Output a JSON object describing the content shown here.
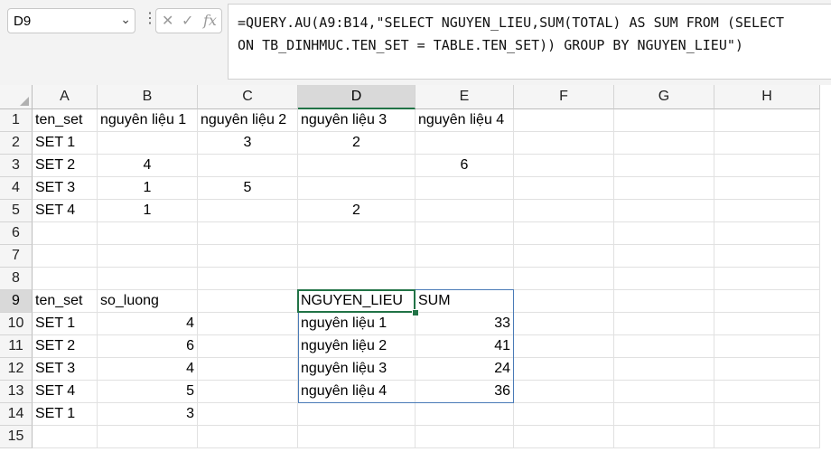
{
  "name_box": "D9",
  "formula": "=QUERY.AU(A9:B14,\"SELECT NGUYEN_LIEU,SUM(TOTAL) AS SUM FROM (SELECT\nON TB_DINHMUC.TEN_SET = TABLE.TEN_SET)) GROUP BY NGUYEN_LIEU\")",
  "columns": [
    "A",
    "B",
    "C",
    "D",
    "E",
    "F",
    "G",
    "H"
  ],
  "rows": [
    "1",
    "2",
    "3",
    "4",
    "5",
    "6",
    "7",
    "8",
    "9",
    "10",
    "11",
    "12",
    "13",
    "14",
    "15"
  ],
  "cells": {
    "A1": "ten_set",
    "B1": "nguyên liệu 1",
    "C1": "nguyên liệu 2",
    "D1": "nguyên liệu 3",
    "E1": "nguyên liệu 4",
    "A2": "SET 1",
    "C2": "3",
    "D2": "2",
    "A3": "SET 2",
    "B3": "4",
    "E3": "6",
    "A4": "SET 3",
    "B4": "1",
    "C4": "5",
    "A5": "SET 4",
    "B5": "1",
    "D5": "2",
    "A9": "ten_set",
    "B9": "so_luong",
    "D9": "NGUYEN_LIEU",
    "E9": "SUM",
    "A10": "SET 1",
    "B10": "4",
    "D10": "nguyên liệu 1",
    "E10": "33",
    "A11": "SET 2",
    "B11": "6",
    "D11": "nguyên liệu 2",
    "E11": "41",
    "A12": "SET 3",
    "B12": "4",
    "D12": "nguyên liệu 3",
    "E12": "24",
    "A13": "SET 4",
    "B13": "5",
    "D13": "nguyên liệu 4",
    "E13": "36",
    "A14": "SET 1",
    "B14": "3"
  },
  "selected_column": "D",
  "selected_row": "9",
  "colors": {
    "accent": "#217346",
    "result_border": "#4a7bb7"
  }
}
